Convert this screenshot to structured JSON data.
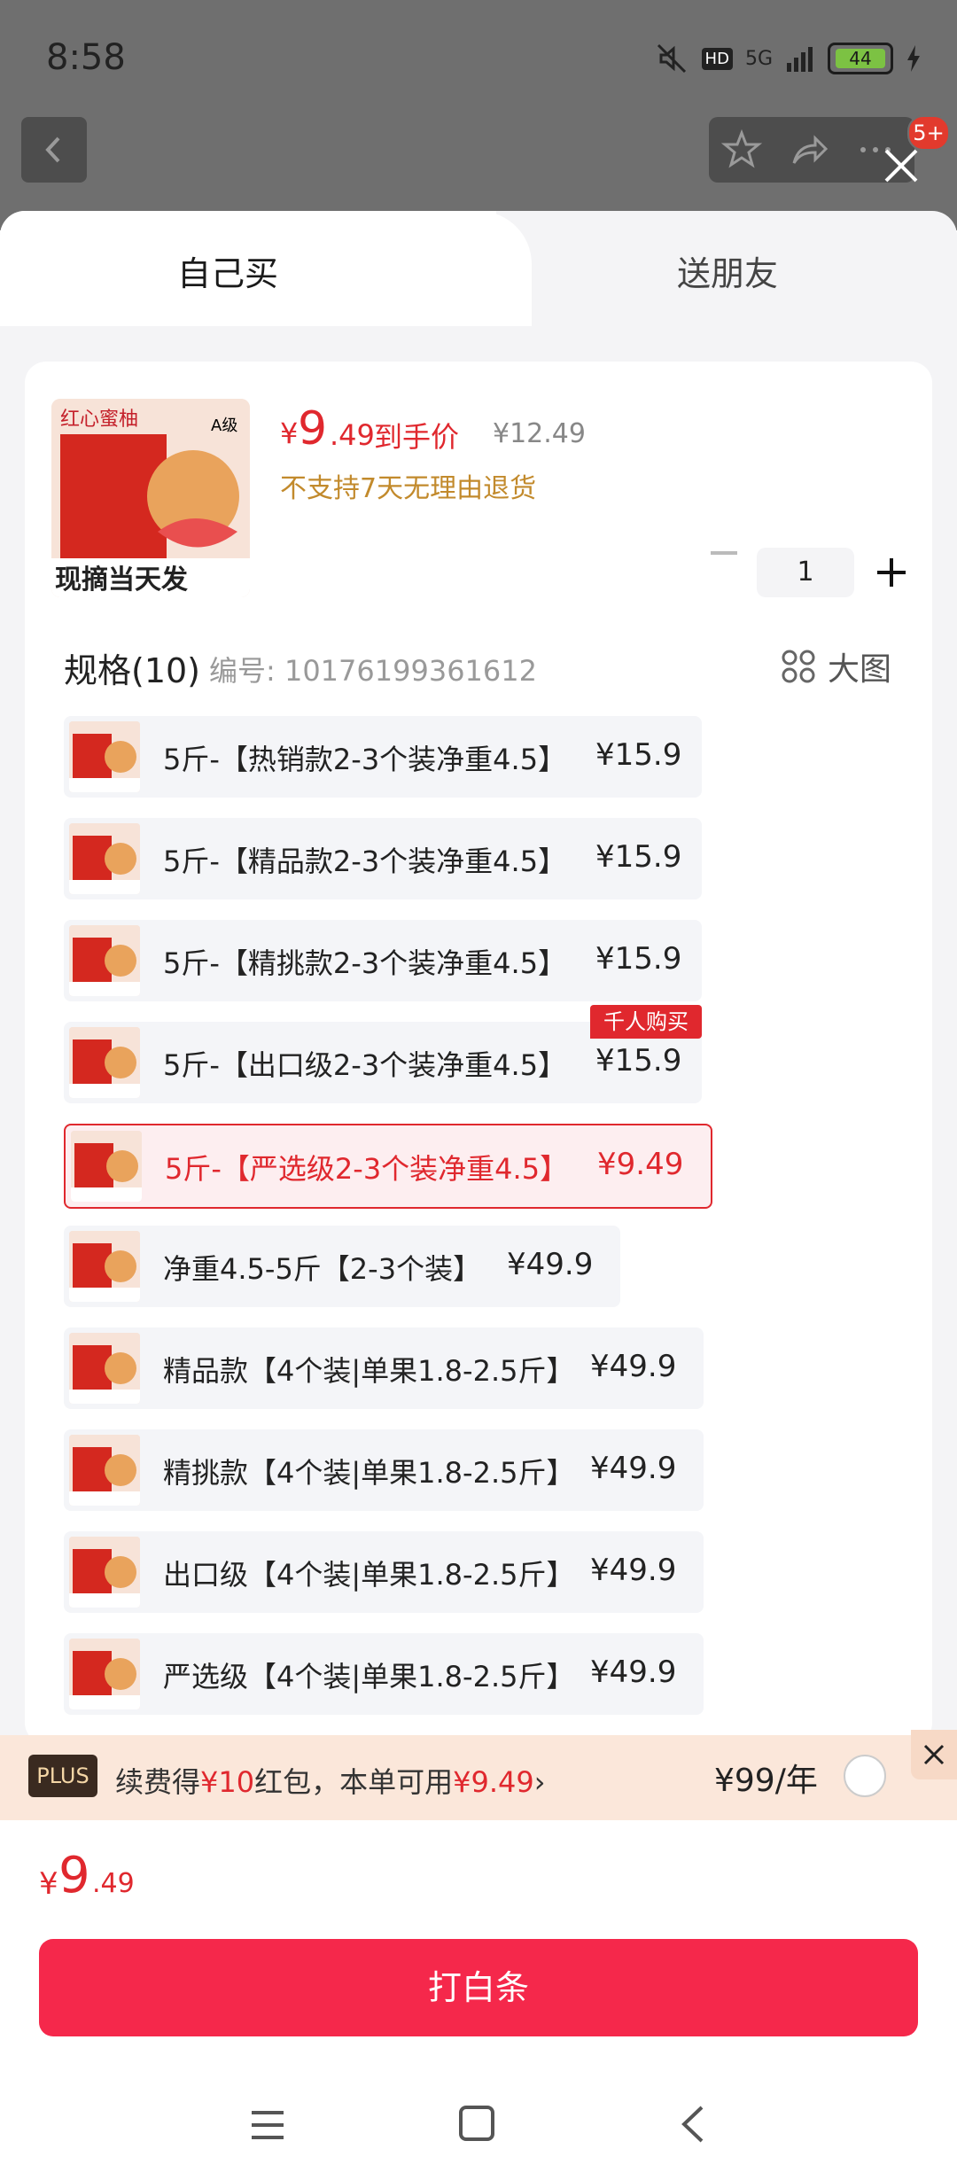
{
  "status_bar": {
    "time": "8:58",
    "network": "5G",
    "hd": "HD",
    "battery": "44"
  },
  "top_bar": {
    "badge": "5+"
  },
  "tabs": [
    {
      "label": "自己买",
      "active": true
    },
    {
      "label": "送朋友",
      "active": false
    }
  ],
  "product": {
    "image_text_top": "红心蜜柚",
    "image_text_bottom": "现摘当天发",
    "image_grade": "A级",
    "price_currency": "¥",
    "price_int": "9",
    "price_dec": ".49",
    "price_note": "到手价",
    "original_price": "¥12.49",
    "return_policy": "不支持7天无理由退货",
    "quantity": "1"
  },
  "spec": {
    "title": "规格(10)",
    "code": "编号: 10176199361612",
    "big_image_label": "大图",
    "options": [
      {
        "label": "5斤-【热销款2-3个装净重4.5】",
        "price": "¥15.9"
      },
      {
        "label": "5斤-【精品款2-3个装净重4.5】",
        "price": "¥15.9"
      },
      {
        "label": "5斤-【精挑款2-3个装净重4.5】",
        "price": "¥15.9"
      },
      {
        "label": "5斤-【出口级2-3个装净重4.5】",
        "price": "¥15.9",
        "tag": "千人购买"
      },
      {
        "label": "5斤-【严选级2-3个装净重4.5】",
        "price": "¥9.49",
        "selected": true
      },
      {
        "label": "净重4.5-5斤【2-3个装】",
        "price": "¥49.9"
      },
      {
        "label": "精品款【4个装|单果1.8-2.5斤】",
        "price": "¥49.9"
      },
      {
        "label": "精挑款【4个装|单果1.8-2.5斤】",
        "price": "¥49.9"
      },
      {
        "label": "出口级【4个装|单果1.8-2.5斤】",
        "price": "¥49.9"
      },
      {
        "label": "严选级【4个装|单果1.8-2.5斤】",
        "price": "¥49.9"
      }
    ]
  },
  "plus_bar": {
    "badge": "PLUS",
    "text_a": "续费得",
    "text_b": "¥10",
    "text_c": "红包，本单可用",
    "text_d": "¥9.49",
    "chevron": "›",
    "price": "¥99/年"
  },
  "footer": {
    "total_currency": "¥",
    "total_int": "9",
    "total_dec": ".49",
    "buy_button": "打白条"
  },
  "colors": {
    "accent": "#e0282e",
    "button": "#f5284b",
    "plus_bg": "#fbe7da"
  }
}
